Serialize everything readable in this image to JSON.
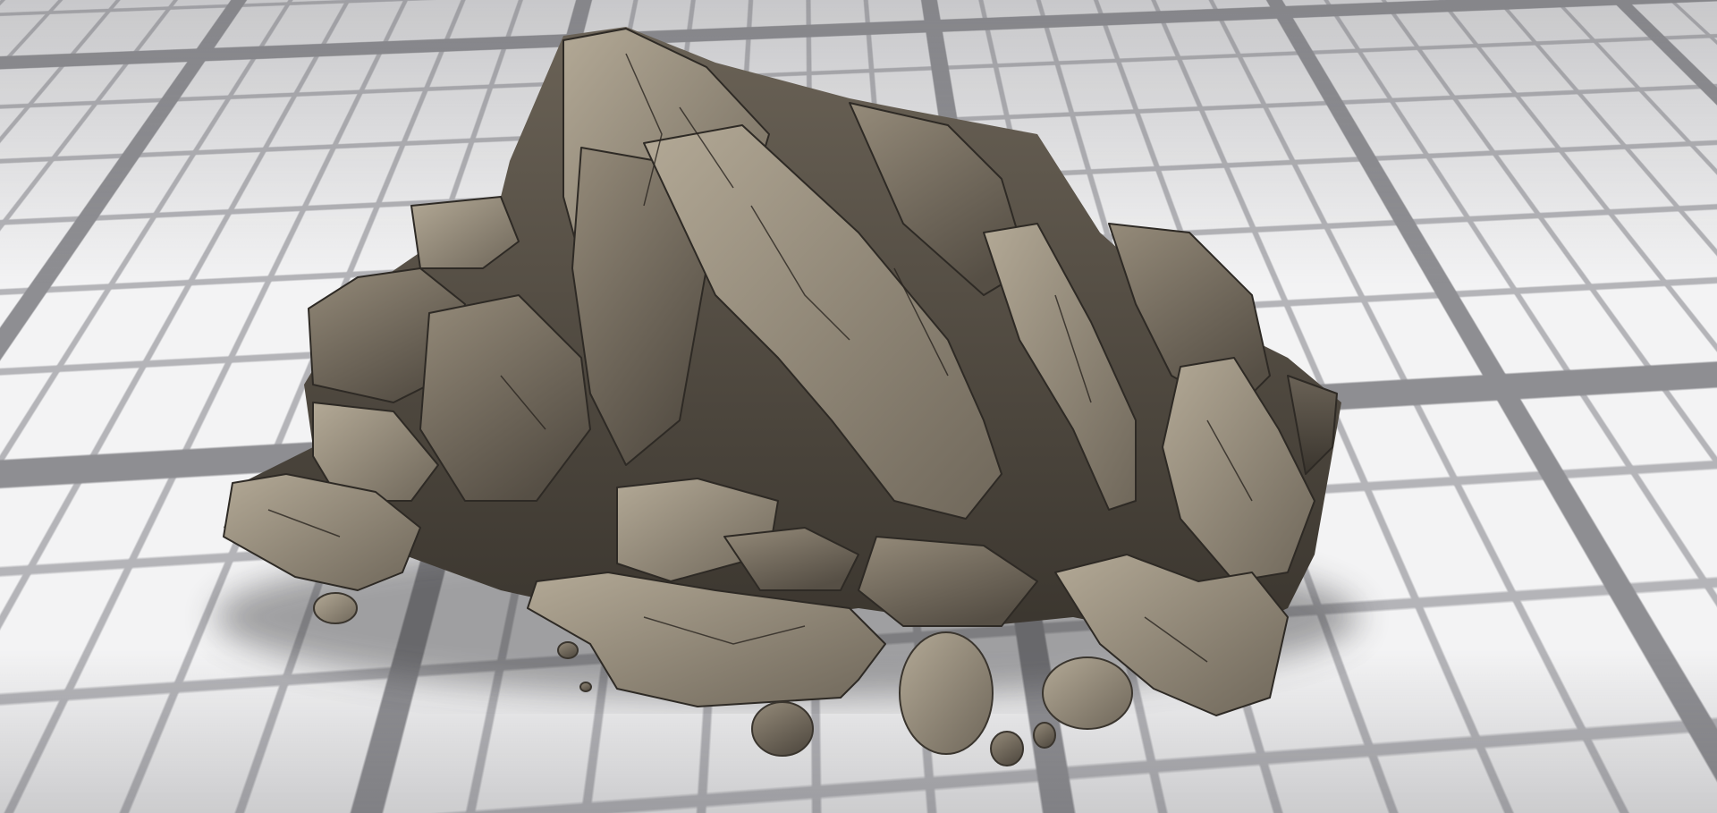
{
  "colors": {
    "floor_tile": "#f3f3f4",
    "floor_major_line": "#8e8e92",
    "floor_minor_line": "#b4b4b8",
    "rock_light": "#a09684",
    "rock_mid": "#7d7465",
    "rock_dark": "#4a443b",
    "rock_shadow": "#2e2a25"
  }
}
